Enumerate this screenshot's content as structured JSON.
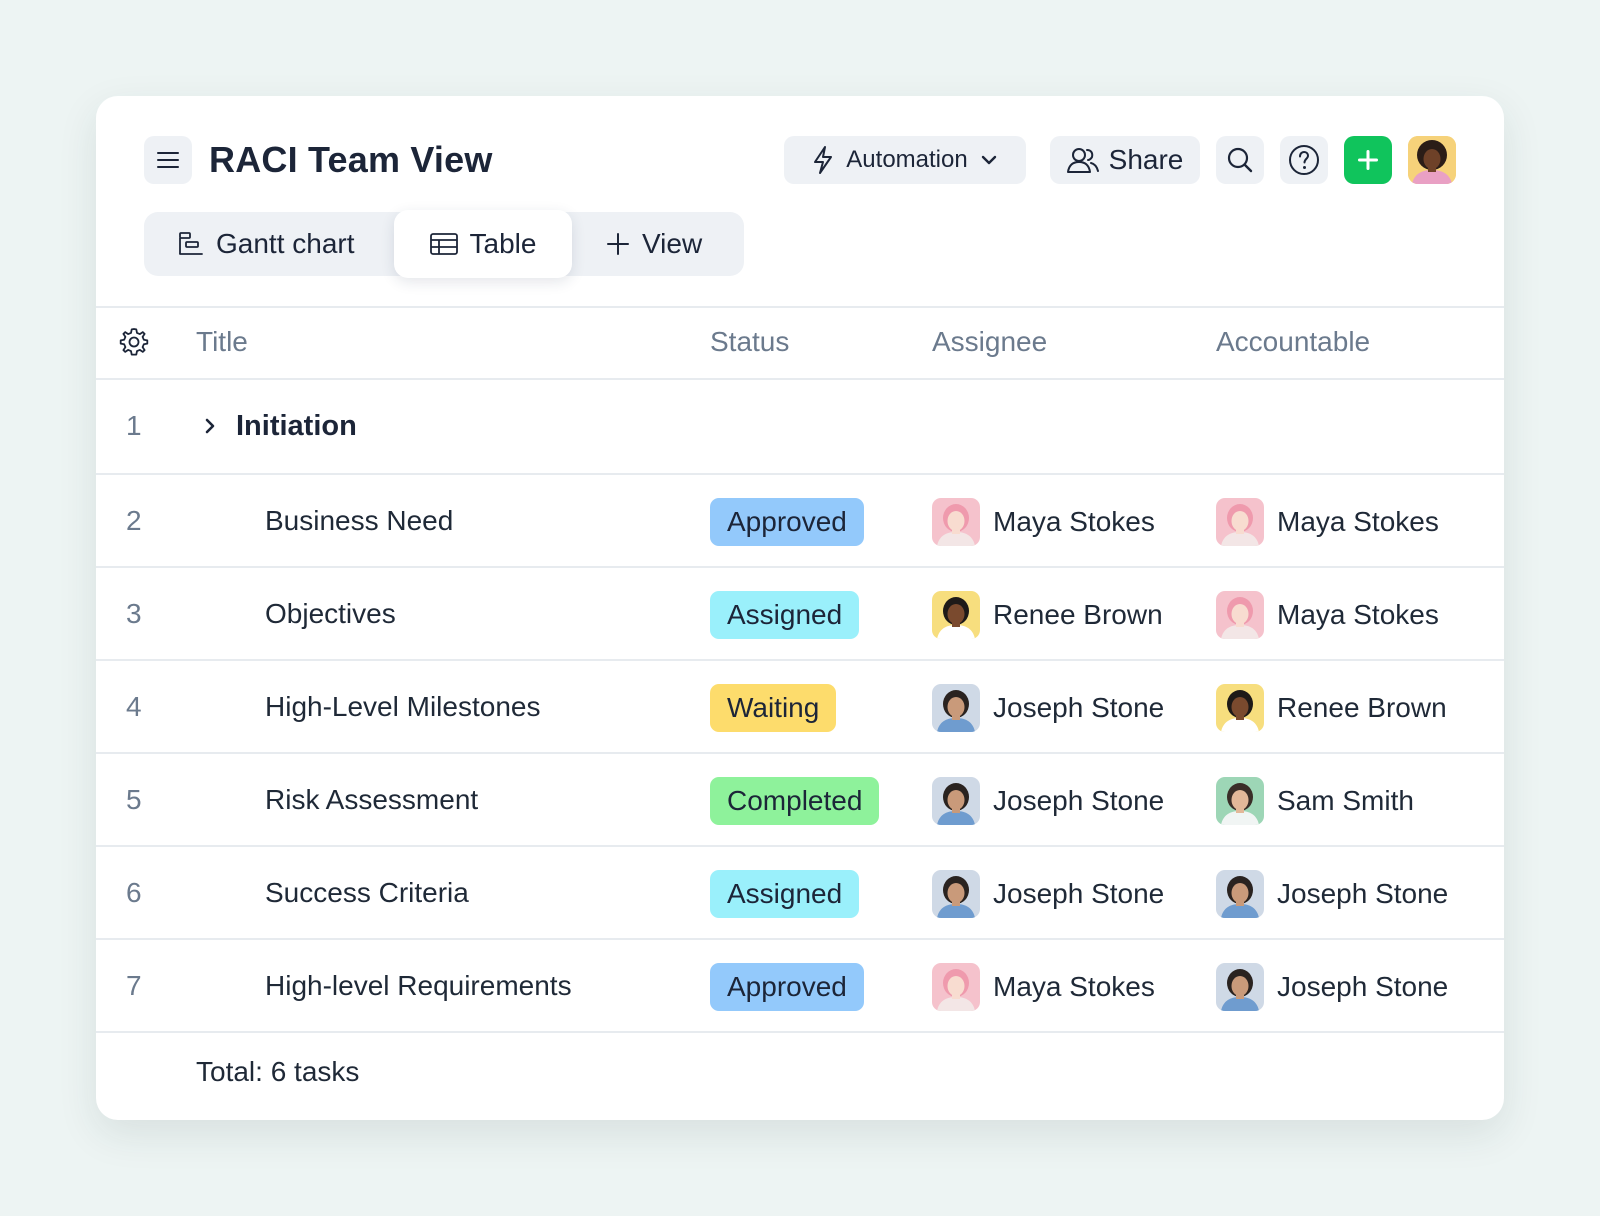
{
  "header": {
    "title": "RACI Team View",
    "menu_icon": "hamburger-menu-icon",
    "automation_label": "Automation",
    "share_label": "Share"
  },
  "tabs": [
    {
      "label": "Gantt chart",
      "icon": "gantt-chart-icon",
      "active": false
    },
    {
      "label": "Table",
      "icon": "table-icon",
      "active": true
    },
    {
      "label": "View",
      "icon": "plus-icon",
      "active": false
    }
  ],
  "columns": {
    "title": "Title",
    "status": "Status",
    "assignee": "Assignee",
    "accountable": "Accountable"
  },
  "group": {
    "num": "1",
    "title": "Initiation"
  },
  "rows": [
    {
      "num": "2",
      "title": "Business Need",
      "status": "Approved",
      "assignee": "Maya Stokes",
      "accountable": "Maya Stokes"
    },
    {
      "num": "3",
      "title": "Objectives",
      "status": "Assigned",
      "assignee": "Renee Brown",
      "accountable": "Maya Stokes"
    },
    {
      "num": "4",
      "title": "High-Level Milestones",
      "status": "Waiting",
      "assignee": "Joseph Stone",
      "accountable": "Renee Brown"
    },
    {
      "num": "5",
      "title": "Risk Assessment",
      "status": "Completed",
      "assignee": "Joseph Stone",
      "accountable": "Sam Smith"
    },
    {
      "num": "6",
      "title": "Success Criteria",
      "status": "Assigned",
      "assignee": "Joseph Stone",
      "accountable": "Joseph Stone"
    },
    {
      "num": "7",
      "title": "High-level Requirements",
      "status": "Approved",
      "assignee": "Maya Stokes",
      "accountable": "Joseph Stone"
    }
  ],
  "status_colors": {
    "Approved": "#93c9fb",
    "Assigned": "#9af0fb",
    "Waiting": "#fddc6c",
    "Completed": "#8ef29b"
  },
  "people": {
    "Maya Stokes": {
      "bg": "#f5c2cc",
      "hair": "#ef9aad",
      "skin": "#f8dcd0",
      "shirt": "#f3e6e6"
    },
    "Renee Brown": {
      "bg": "#f7de7e",
      "hair": "#1e1a18",
      "skin": "#7a4a2e",
      "shirt": "#ffffff"
    },
    "Joseph Stone": {
      "bg": "#cfd9e6",
      "hair": "#2a2320",
      "skin": "#c99a7a",
      "shirt": "#6f9ccf"
    },
    "Sam Smith": {
      "bg": "#9dd6b6",
      "hair": "#3a2e28",
      "skin": "#e3b899",
      "shirt": "#f1f5f4"
    }
  },
  "accent_color": "#10c45c",
  "footer": {
    "total": "Total: 6 tasks"
  }
}
